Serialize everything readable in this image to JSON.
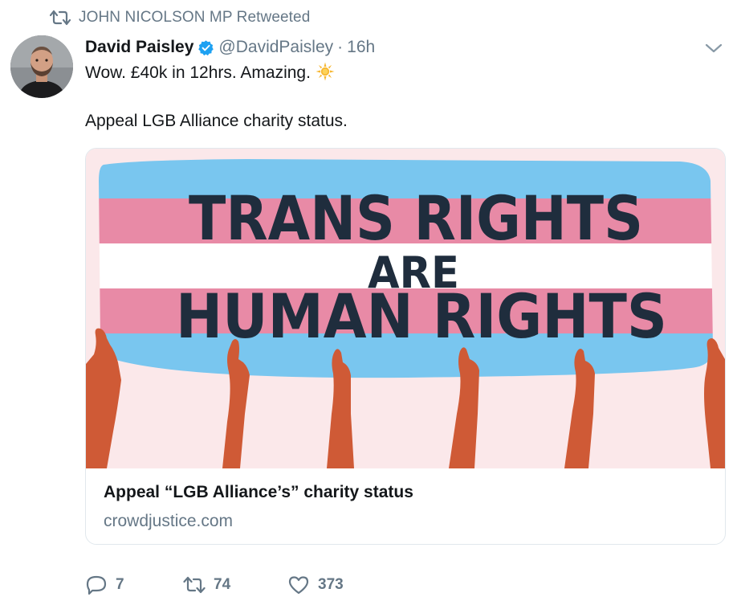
{
  "retweet_context": {
    "icon": "retweet-icon",
    "text": "JOHN NICOLSON MP Retweeted"
  },
  "tweet": {
    "author": {
      "display_name": "David Paisley",
      "verified": true,
      "handle": "@DavidPaisley",
      "avatar_icon": "avatar"
    },
    "separator": "·",
    "timestamp": "16h",
    "text_line1": "Wow. £40k in 12hrs. Amazing.",
    "text_line2": "Appeal LGB Alliance charity status."
  },
  "card": {
    "image": {
      "banner_line1": "TRANS RIGHTS",
      "banner_line2": "ARE",
      "banner_line3": "HUMAN RIGHTS",
      "colors": {
        "blue": "#79c6ef",
        "pink": "#e88aa6",
        "white": "#ffffff",
        "text": "#1f2d3d",
        "arm": "#cf5a36",
        "background": "#fbe8ea"
      }
    },
    "title": "Appeal “LGB Alliance’s” charity status",
    "domain": "crowdjustice.com"
  },
  "actions": {
    "reply_count": "7",
    "retweet_count": "74",
    "like_count": "373"
  },
  "colors": {
    "secondary_text": "#657786",
    "verified_blue": "#1da1f2",
    "card_border": "#e1e8ed"
  }
}
